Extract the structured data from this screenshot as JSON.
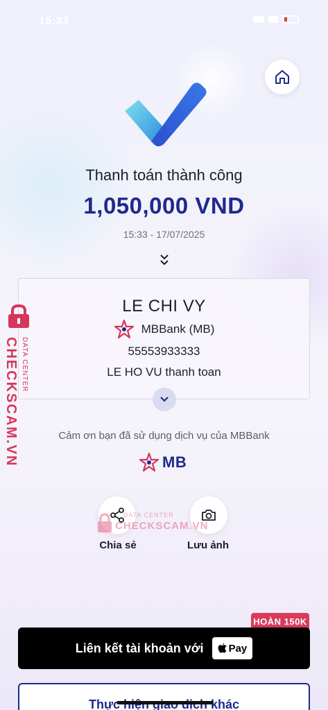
{
  "status_bar": {
    "time": "15:33"
  },
  "receipt": {
    "title": "Thanh toán thành công",
    "amount": "1,050,000 VND",
    "datetime": "15:33 - 17/07/2025",
    "recipient_name": "LE CHI VY",
    "bank": "MBBank (MB)",
    "account_number": "55553933333",
    "memo": "LE HO VU thanh toan"
  },
  "footer": {
    "thanks": "Cảm ơn bạn đã sử dụng dịch vụ của MBBank",
    "logo_text": "MB"
  },
  "actions": {
    "share_label": "Chia sẻ",
    "save_label": "Lưu ảnh"
  },
  "promo": {
    "badge": "HOÀN 150K",
    "link_label": "Liên kết tài khoản với",
    "pay_label": "Pay"
  },
  "other_transaction_label": "Thực hiện giao dịch khác",
  "watermark": {
    "brand": "CHECKSCAM.VN",
    "sub": "DATA CENTER"
  },
  "colors": {
    "brand_blue": "#1e2a8c",
    "brand_red": "#d6365c",
    "check_blue": "#2f6bdb",
    "check_cyan": "#49c6e5"
  },
  "icons": [
    "home-icon",
    "checkmark-icon",
    "double-chevron-down-icon",
    "chevron-down-icon",
    "mb-star-icon",
    "share-icon",
    "camera-icon",
    "lock-icon",
    "apple-icon"
  ]
}
